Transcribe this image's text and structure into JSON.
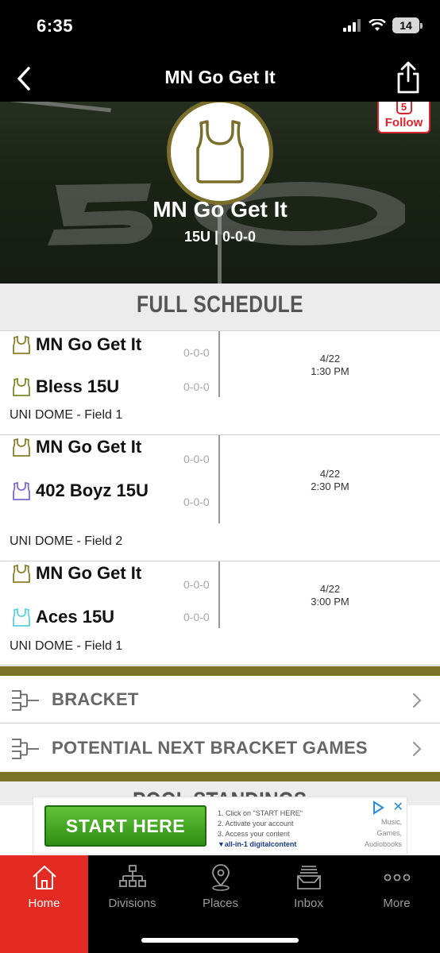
{
  "status_bar": {
    "time": "6:35",
    "battery": "14"
  },
  "nav": {
    "title": "MN Go Get It"
  },
  "hero": {
    "team_name": "MN Go Get It",
    "subtitle": "15U | 0-0-0",
    "follow": {
      "count": "5",
      "label": "Follow"
    },
    "accent_color": "#7a6f2a"
  },
  "schedule": {
    "header": "FULL SCHEDULE",
    "games": [
      {
        "home": {
          "name": "MN Go Get It",
          "record": "0-0-0",
          "jersey_color": "#8a7d2a"
        },
        "away": {
          "name": "Bless 15U",
          "record": "0-0-0",
          "jersey_color": "#7a8a2a"
        },
        "date": "4/22",
        "time": "1:30 PM",
        "venue": "UNI DOME - Field 1"
      },
      {
        "home": {
          "name": "MN Go Get It",
          "record": "0-0-0",
          "jersey_color": "#8a7d2a"
        },
        "away": {
          "name": "402 Boyz 15U",
          "record": "0-0-0",
          "jersey_color": "#7a6ad6"
        },
        "date": "4/22",
        "time": "2:30 PM",
        "venue": "UNI DOME - Field 2"
      },
      {
        "home": {
          "name": "MN Go Get It",
          "record": "0-0-0",
          "jersey_color": "#8a7d2a"
        },
        "away": {
          "name": "Aces 15U",
          "record": "0-0-0",
          "jersey_color": "#5ad0e0"
        },
        "date": "4/22",
        "time": "3:00 PM",
        "venue": "UNI DOME - Field 1"
      }
    ]
  },
  "links": [
    {
      "label": "BRACKET"
    },
    {
      "label": "POTENTIAL NEXT BRACKET GAMES"
    }
  ],
  "pool_standings_header": "POOL STANDINGS",
  "ad": {
    "button": "START HERE",
    "steps": [
      "1. Click on \"START HERE\"",
      "2. Activate your account",
      "3. Access your content"
    ],
    "brand": "▼all-in-1 digitalcontent",
    "side": [
      "Music,",
      "Games,",
      "Audiobooks"
    ]
  },
  "tabs": [
    {
      "label": "Home",
      "icon": "home-icon",
      "active": true
    },
    {
      "label": "Divisions",
      "icon": "hierarchy-icon",
      "active": false
    },
    {
      "label": "Places",
      "icon": "map-pin-icon",
      "active": false
    },
    {
      "label": "Inbox",
      "icon": "inbox-icon",
      "active": false
    },
    {
      "label": "More",
      "icon": "more-icon",
      "active": false
    }
  ],
  "colors": {
    "olive": "#7b7228",
    "active_tab": "#e32b24",
    "follow_red": "#d8242c"
  }
}
